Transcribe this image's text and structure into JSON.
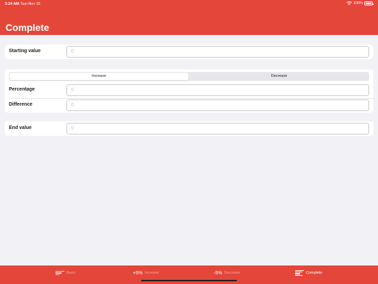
{
  "status_bar": {
    "time": "3:24 AM",
    "date": "Sun Nov 15",
    "battery": "100%"
  },
  "header": {
    "title": "Complete"
  },
  "starting_value": {
    "label": "Starting value",
    "placeholder": "0"
  },
  "mode": {
    "options": [
      "Increase",
      "Decrease"
    ],
    "selected": "Increase"
  },
  "percentage": {
    "label": "Percentage",
    "placeholder": "0"
  },
  "difference": {
    "label": "Difference",
    "placeholder": "0"
  },
  "end_value": {
    "label": "End value",
    "placeholder": "0"
  },
  "tabbar": {
    "tabs": [
      {
        "label": "Basic",
        "icon": "bars-icon"
      },
      {
        "glyph": "+5%",
        "label": "Increase"
      },
      {
        "glyph": "-5%",
        "label": "Decrease"
      },
      {
        "label": "Complete",
        "icon": "bars-icon"
      }
    ],
    "active": "Complete"
  },
  "colors": {
    "accent": "#e4463a",
    "background": "#f2f2f6"
  }
}
